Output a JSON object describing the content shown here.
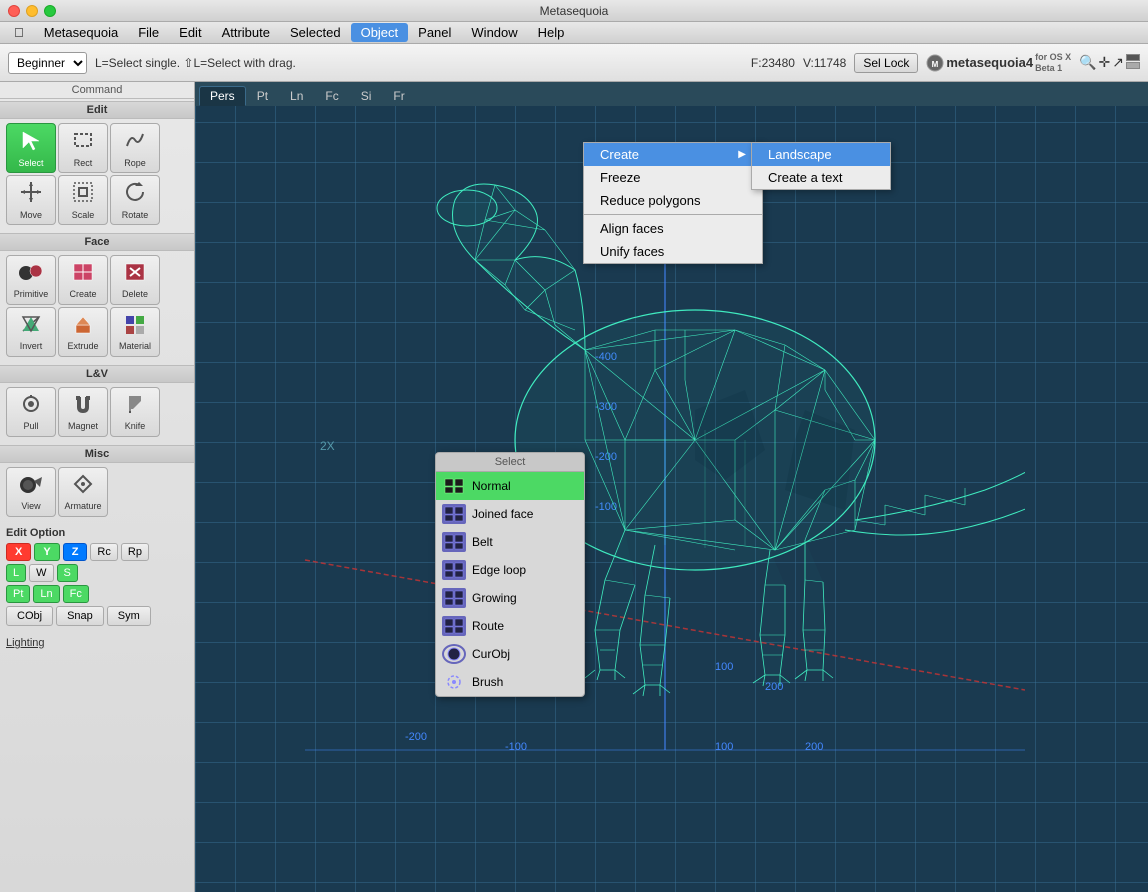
{
  "app": {
    "title": "Metasequoia",
    "logo": "metasequoia4"
  },
  "titlebar": {
    "title": "Metasequoia"
  },
  "menubar": {
    "items": [
      {
        "id": "apple",
        "label": ""
      },
      {
        "id": "metasequoia",
        "label": "Metasequoia"
      },
      {
        "id": "file",
        "label": "File"
      },
      {
        "id": "edit",
        "label": "Edit"
      },
      {
        "id": "attribute",
        "label": "Attribute"
      },
      {
        "id": "selected",
        "label": "Selected"
      },
      {
        "id": "object",
        "label": "Object",
        "active": true
      },
      {
        "id": "panel",
        "label": "Panel"
      },
      {
        "id": "window",
        "label": "Window"
      },
      {
        "id": "help",
        "label": "Help"
      }
    ]
  },
  "toolbar": {
    "mode": "Beginner",
    "info": "L=Select single.  ⇧L=Select with drag.",
    "f_count": "F:23480",
    "v_count": "V:11748",
    "sel_lock": "Sel Lock",
    "logo_text": "metasequoia4",
    "logo_sub": "for OS X\nBeta 1"
  },
  "viewport": {
    "tabs": [
      "Pers",
      "Pt",
      "Ln",
      "Fc",
      "Si",
      "Fr"
    ]
  },
  "sidebar": {
    "sections": {
      "edit": {
        "header": "Edit",
        "tools": [
          {
            "id": "select",
            "label": "Select",
            "icon": "↖",
            "active": true
          },
          {
            "id": "rect",
            "label": "Rect",
            "icon": "□"
          },
          {
            "id": "rope",
            "label": "Rope",
            "icon": "∼"
          },
          {
            "id": "move",
            "label": "Move",
            "icon": "✜"
          },
          {
            "id": "scale",
            "label": "Scale",
            "icon": "■"
          },
          {
            "id": "rotate",
            "label": "Rotate",
            "icon": "↺"
          }
        ]
      },
      "face": {
        "header": "Face",
        "tools": [
          {
            "id": "primitive",
            "label": "Primitive",
            "icon": "●"
          },
          {
            "id": "create",
            "label": "Create",
            "icon": "■"
          },
          {
            "id": "delete",
            "label": "Delete",
            "icon": "✕"
          },
          {
            "id": "invert",
            "label": "Invert",
            "icon": "⇄"
          },
          {
            "id": "extrude",
            "label": "Extrude",
            "icon": "▲"
          },
          {
            "id": "material",
            "label": "Material",
            "icon": "█"
          }
        ]
      },
      "lv": {
        "header": "L&V",
        "tools": [
          {
            "id": "pull",
            "label": "Pull",
            "icon": "⊕"
          },
          {
            "id": "magnet",
            "label": "Magnet",
            "icon": "⨁"
          },
          {
            "id": "knife",
            "label": "Knife",
            "icon": "⁄"
          }
        ]
      },
      "misc": {
        "header": "Misc",
        "tools": [
          {
            "id": "view",
            "label": "View",
            "icon": "●"
          },
          {
            "id": "armature",
            "label": "Armature",
            "icon": "◇"
          }
        ]
      }
    },
    "edit_option": {
      "title": "Edit Option",
      "axes": [
        "X",
        "Y",
        "Z"
      ],
      "options": [
        "Rc",
        "Rp",
        "L",
        "W",
        "S"
      ],
      "modes": [
        "Pt",
        "Ln",
        "Fc"
      ],
      "buttons": [
        "CObj",
        "Snap",
        "Sym"
      ]
    },
    "lighting": "Lighting"
  },
  "object_menu": {
    "items": [
      {
        "id": "create",
        "label": "Create",
        "has_submenu": true,
        "active": true
      },
      {
        "id": "freeze",
        "label": "Freeze"
      },
      {
        "id": "reduce",
        "label": "Reduce polygons"
      },
      {
        "id": "sep1",
        "type": "separator"
      },
      {
        "id": "align",
        "label": "Align faces"
      },
      {
        "id": "unify",
        "label": "Unify faces"
      }
    ]
  },
  "landscape_submenu": {
    "items": [
      {
        "id": "landscape",
        "label": "Landscape",
        "active": true
      },
      {
        "id": "text",
        "label": "Create a text"
      }
    ]
  },
  "select_panel": {
    "header": "Select",
    "items": [
      {
        "id": "normal",
        "label": "Normal",
        "active": true
      },
      {
        "id": "joined",
        "label": "Joined face"
      },
      {
        "id": "belt",
        "label": "Belt"
      },
      {
        "id": "edge_loop",
        "label": "Edge loop"
      },
      {
        "id": "growing",
        "label": "Growing"
      },
      {
        "id": "route",
        "label": "Route"
      },
      {
        "id": "curobj",
        "label": "CurObj"
      },
      {
        "id": "brush",
        "label": "Brush"
      }
    ]
  },
  "axis_labels": {
    "positive_labels": [
      "100",
      "200",
      "-100",
      "-200",
      "-300",
      "-400",
      "-300",
      "-200",
      "-100",
      "100",
      "200"
    ],
    "colors": {
      "x_axis": "#cc4444",
      "y_axis": "#4444cc",
      "z_axis": "#44cc44"
    }
  }
}
